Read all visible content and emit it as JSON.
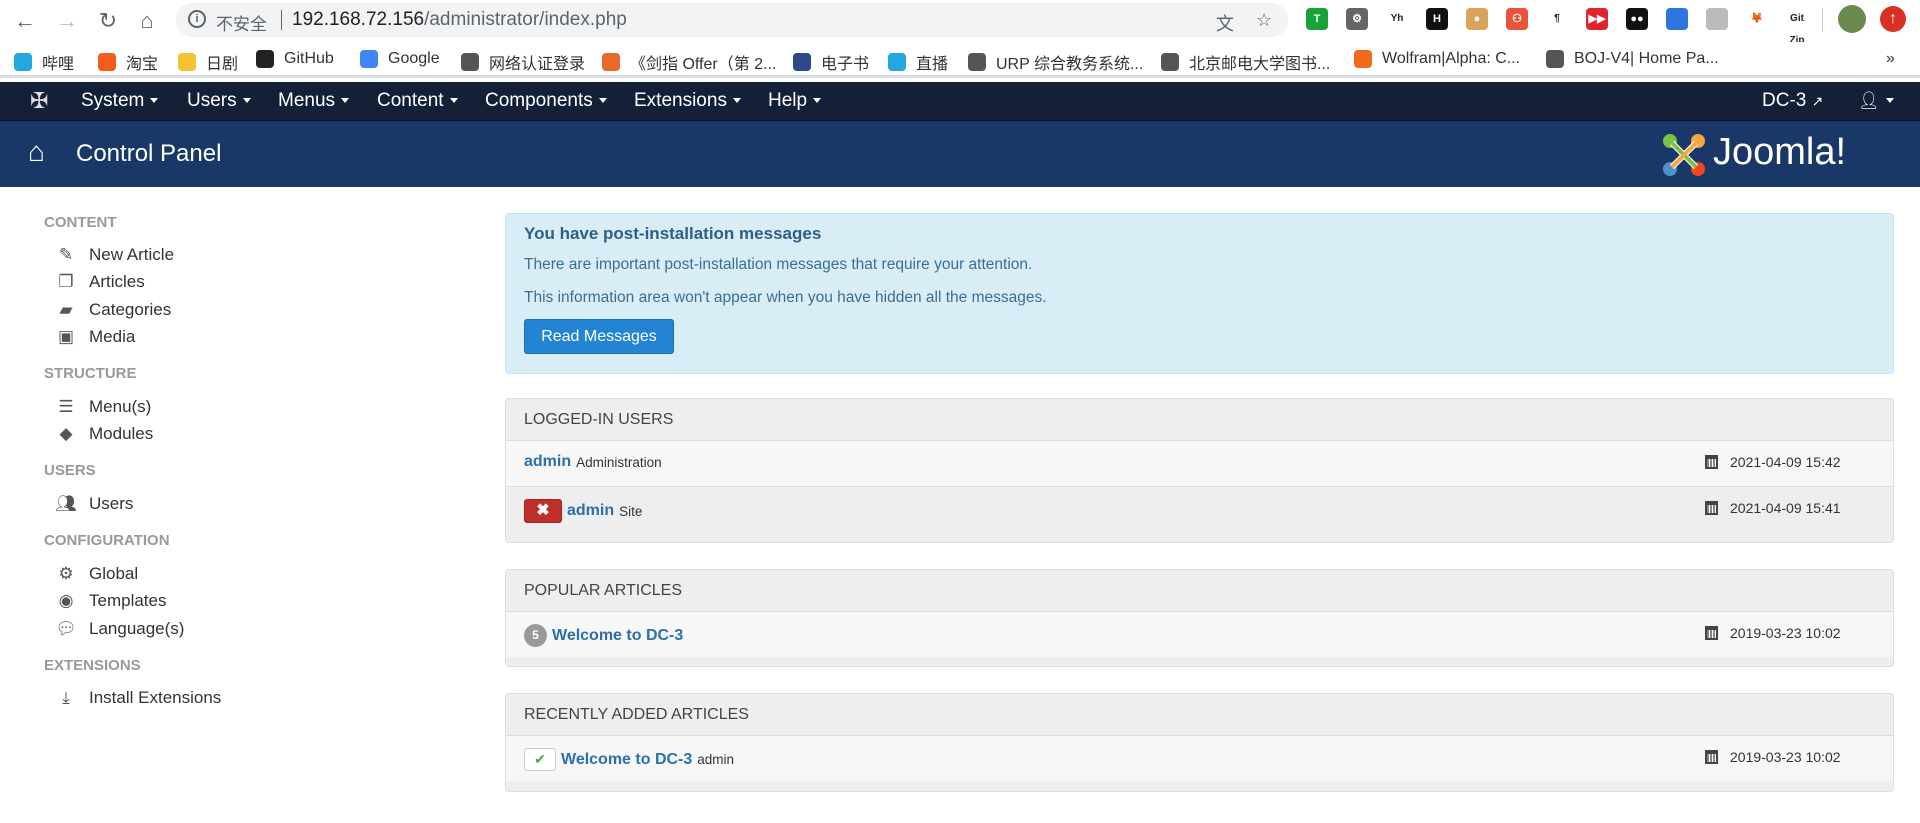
{
  "browser": {
    "security_label": "不安全",
    "url_host": "192.168.72.156",
    "url_path": "/administrator/index.php",
    "extensions": [
      {
        "label": "T",
        "color": "#1aa23a"
      },
      {
        "label": "⚙",
        "color": "#666"
      },
      {
        "label": "Yh",
        "color": "#fff"
      },
      {
        "label": "H",
        "color": "#111"
      },
      {
        "label": "●",
        "color": "#d9a35a"
      },
      {
        "label": "⚇",
        "color": "#e8553a"
      },
      {
        "label": "¶",
        "color": "#fff"
      },
      {
        "label": "▶▶",
        "color": "#e0242b"
      },
      {
        "label": "●●",
        "color": "#111"
      },
      {
        "label": "",
        "color": "#2f74e0"
      },
      {
        "label": "",
        "color": "#bbb"
      },
      {
        "label": "🦊",
        "color": "#fff"
      },
      {
        "label": "Git Zip",
        "color": "#fff"
      }
    ],
    "bookmarks": [
      {
        "label": "哔哩",
        "color": "#22a7e0"
      },
      {
        "label": "淘宝",
        "color": "#f45c1e"
      },
      {
        "label": "日剧",
        "color": "#f2c230"
      },
      {
        "label": "GitHub",
        "color": "#222"
      },
      {
        "label": "Google",
        "color": "#4285f4"
      },
      {
        "label": "网络认证登录",
        "color": "#555"
      },
      {
        "label": "《剑指 Offer（第 2...",
        "color": "#e86a2a"
      },
      {
        "label": "电子书",
        "color": "#2a4a8a"
      },
      {
        "label": "直播",
        "color": "#22a7e0"
      },
      {
        "label": "URP 综合教务系统...",
        "color": "#555"
      },
      {
        "label": "北京邮电大学图书...",
        "color": "#555"
      },
      {
        "label": "Wolfram|Alpha: C...",
        "color": "#f26a1b"
      },
      {
        "label": "BOJ-V4| Home Pa...",
        "color": "#555"
      }
    ],
    "more": "»"
  },
  "nav": {
    "items": [
      "System",
      "Users",
      "Menus",
      "Content",
      "Components",
      "Extensions",
      "Help"
    ],
    "site_label": "DC-3"
  },
  "header": {
    "title": "Control Panel",
    "logo_text": "Joomla!"
  },
  "sidebar": [
    {
      "heading": "CONTENT",
      "items": [
        {
          "icon": "pencil",
          "label": "New Article"
        },
        {
          "icon": "copy",
          "label": "Articles"
        },
        {
          "icon": "folder-open",
          "label": "Categories"
        },
        {
          "icon": "image",
          "label": "Media"
        }
      ]
    },
    {
      "heading": "STRUCTURE",
      "items": [
        {
          "icon": "list",
          "label": "Menu(s)"
        },
        {
          "icon": "cube",
          "label": "Modules"
        }
      ]
    },
    {
      "heading": "USERS",
      "items": [
        {
          "icon": "users",
          "label": "Users"
        }
      ]
    },
    {
      "heading": "CONFIGURATION",
      "items": [
        {
          "icon": "cog",
          "label": "Global"
        },
        {
          "icon": "eye",
          "label": "Templates"
        },
        {
          "icon": "comments",
          "label": "Language(s)"
        }
      ]
    },
    {
      "heading": "EXTENSIONS",
      "items": [
        {
          "icon": "download",
          "label": "Install Extensions"
        }
      ]
    }
  ],
  "alert": {
    "title": "You have post-installation messages",
    "line1": "There are important post-installation messages that require your attention.",
    "line2": "This information area won't appear when you have hidden all the messages.",
    "button": "Read Messages"
  },
  "logged_in": {
    "title": "LOGGED-IN USERS",
    "rows": [
      {
        "user": "admin",
        "client": "Administration",
        "date": "2021-04-09 15:42"
      },
      {
        "user": "admin",
        "client": "Site",
        "date": "2021-04-09 15:41",
        "logout": "✖"
      }
    ]
  },
  "popular": {
    "title": "POPULAR ARTICLES",
    "rows": [
      {
        "hits": "5",
        "title": "Welcome to DC-3",
        "date": "2019-03-23 10:02"
      }
    ]
  },
  "recent": {
    "title": "RECENTLY ADDED ARTICLES",
    "rows": [
      {
        "status": "✔",
        "title": "Welcome to DC-3",
        "author": "admin",
        "date": "2019-03-23 10:02"
      }
    ]
  }
}
